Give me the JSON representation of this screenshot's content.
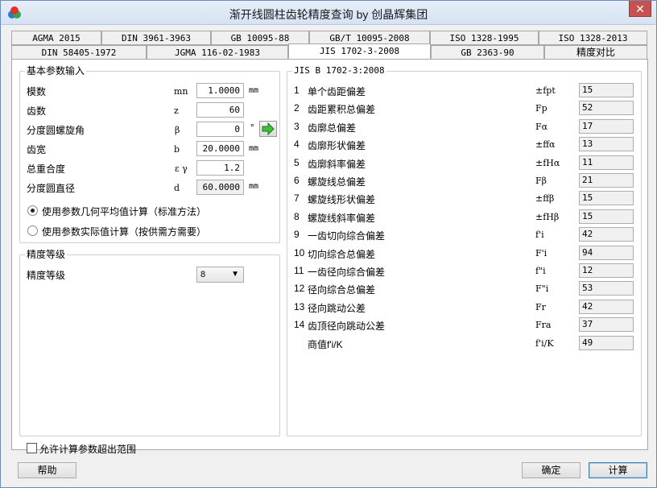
{
  "window": {
    "title": "渐开线圆柱齿轮精度查询 by 创晶辉集团",
    "close": "✕"
  },
  "tabs_row1": [
    "AGMA 2015",
    "DIN 3961-3963",
    "GB 10095-88",
    "GB/T 10095-2008",
    "ISO 1328-1995",
    "ISO 1328-2013"
  ],
  "tabs_row2": [
    "DIN 58405-1972",
    "JGMA 116-02-1983",
    "JIS 1702-3-2008",
    "GB 2363-90",
    "精度对比"
  ],
  "basic": {
    "title": "基本参数输入",
    "rows": [
      {
        "label": "模数",
        "symbol": "mn",
        "value": "1.0000",
        "unit": "mm"
      },
      {
        "label": "齿数",
        "symbol": "z",
        "value": "60",
        "unit": ""
      },
      {
        "label": "分度圆螺旋角",
        "symbol": "β",
        "value": "0",
        "unit": "°"
      },
      {
        "label": "齿宽",
        "symbol": "b",
        "value": "20.0000",
        "unit": "mm"
      },
      {
        "label": "总重合度",
        "symbol": "ε γ",
        "value": "1.2",
        "unit": ""
      },
      {
        "label": "分度圆直径",
        "symbol": "d",
        "value": "60.0000",
        "unit": "mm"
      }
    ],
    "radio1": "使用参数几何平均值计算（标准方法）",
    "radio2": "使用参数实际值计算（按供需方需要）"
  },
  "grade": {
    "title": "精度等级",
    "label": "精度等级",
    "value": "8"
  },
  "results": {
    "title": "JIS B 1702-3:2008",
    "rows": [
      {
        "num": "1",
        "name": "单个齿距偏差",
        "symbol": "±fpt",
        "value": "15"
      },
      {
        "num": "2",
        "name": "齿距累积总偏差",
        "symbol": "Fp",
        "value": "52"
      },
      {
        "num": "3",
        "name": "齿廓总偏差",
        "symbol": "Fα",
        "value": "17"
      },
      {
        "num": "4",
        "name": "齿廓形状偏差",
        "symbol": "±ffα",
        "value": "13"
      },
      {
        "num": "5",
        "name": "齿廓斜率偏差",
        "symbol": "±fHα",
        "value": "11"
      },
      {
        "num": "6",
        "name": "螺旋线总偏差",
        "symbol": "Fβ",
        "value": "21"
      },
      {
        "num": "7",
        "name": "螺旋线形状偏差",
        "symbol": "±ffβ",
        "value": "15"
      },
      {
        "num": "8",
        "name": "螺旋线斜率偏差",
        "symbol": "±fHβ",
        "value": "15"
      },
      {
        "num": "9",
        "name": "一齿切向综合偏差",
        "symbol": "f'i",
        "value": "42"
      },
      {
        "num": "10",
        "name": "切向综合总偏差",
        "symbol": "F'i",
        "value": "94"
      },
      {
        "num": "11",
        "name": "一齿径向综合偏差",
        "symbol": "f\"i",
        "value": "12"
      },
      {
        "num": "12",
        "name": "径向综合总偏差",
        "symbol": "F\"i",
        "value": "53"
      },
      {
        "num": "13",
        "name": "径向跳动公差",
        "symbol": "Fr",
        "value": "42"
      },
      {
        "num": "14",
        "name": "齿顶径向跳动公差",
        "symbol": "Fra",
        "value": "37"
      },
      {
        "num": "",
        "name": "商值f'i/K",
        "symbol": "f'i/K",
        "value": "49"
      }
    ]
  },
  "allow_checkbox": "允许计算参数超出范围",
  "buttons": {
    "help": "帮助",
    "ok": "确定",
    "calc": "计算"
  }
}
